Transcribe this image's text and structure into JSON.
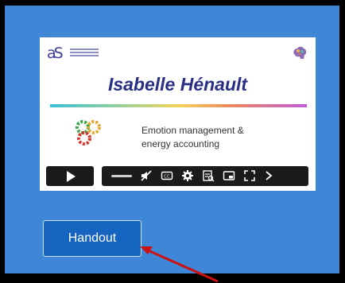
{
  "video": {
    "title": "Isabelle Hénault",
    "subtitle_line1": "Emotion management &",
    "subtitle_line2": "energy accounting",
    "logo_text": "aS"
  },
  "handout": {
    "label": "Handout"
  },
  "colors": {
    "panel_bg": "#3f86d6",
    "button_bg": "#1565c0",
    "title_color": "#2a2f86",
    "arrow_color": "#cc1111"
  },
  "icons": [
    "play-icon",
    "volume-icon",
    "mute-icon",
    "captions-icon",
    "settings-icon",
    "transcript-icon",
    "pip-icon",
    "fullscreen-icon",
    "next-icon"
  ]
}
